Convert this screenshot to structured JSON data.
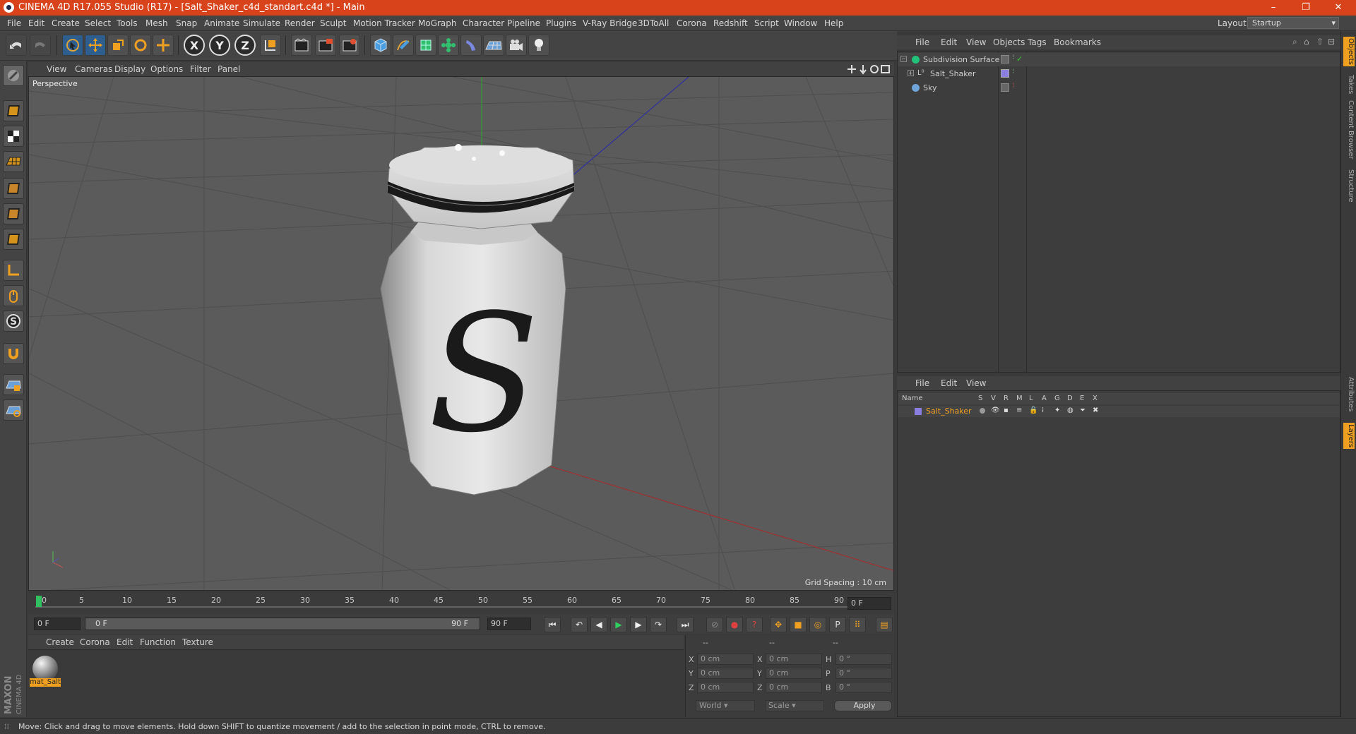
{
  "window": {
    "title": "CINEMA 4D R17.055 Studio (R17) - [Salt_Shaker_c4d_standart.c4d *] - Main",
    "controls": [
      "–",
      "❐",
      "✕"
    ],
    "accent_color": "#d8431b"
  },
  "menubar": {
    "items": [
      "File",
      "Edit",
      "Create",
      "Select",
      "Tools",
      "Mesh",
      "Snap",
      "Animate",
      "Simulate",
      "Render",
      "Sculpt",
      "Motion Tracker",
      "MoGraph",
      "Character",
      "Pipeline",
      "Plugins",
      "V-Ray Bridge",
      "3DToAll",
      "Corona",
      "Redshift",
      "Script",
      "Window",
      "Help"
    ],
    "layout_label": "Layout:",
    "layout_value": "Startup"
  },
  "toolbar": {
    "axis_x": "X",
    "axis_y": "Y",
    "axis_z": "Z",
    "icons": [
      "undo-icon",
      "redo-icon",
      "select-icon",
      "move-icon",
      "scale-icon",
      "rotate-icon",
      "transform-icon",
      "axis-x-icon",
      "axis-y-icon",
      "axis-z-icon",
      "coordinate-system-icon",
      "render-view-icon",
      "render-picture-viewer-icon",
      "render-settings-icon",
      "cube-icon",
      "spline-pen-icon",
      "subdivision-icon",
      "array-icon",
      "deformer-icon",
      "floor-icon",
      "camera-icon",
      "light-icon"
    ]
  },
  "viewport": {
    "menu": [
      "View",
      "Cameras",
      "Display",
      "Options",
      "Filter",
      "Panel"
    ],
    "label": "Perspective",
    "grid_spacing": "Grid Spacing : 10 cm",
    "object_letter": "S"
  },
  "timeline": {
    "ticks": [
      "0",
      "5",
      "10",
      "15",
      "20",
      "25",
      "30",
      "35",
      "40",
      "45",
      "50",
      "55",
      "60",
      "65",
      "70",
      "75",
      "80",
      "85",
      "90"
    ],
    "current_frame": "0 F",
    "start_frame": "0 F",
    "range_start": "0 F",
    "range_end": "90 F",
    "end_frame": "90 F"
  },
  "material_manager": {
    "menu": [
      "Create",
      "Corona",
      "Edit",
      "Function",
      "Texture"
    ],
    "material_name": "mat_Salt"
  },
  "coordinates": {
    "header": [
      "--",
      "--",
      "--"
    ],
    "rows": [
      {
        "axis": "X",
        "pos": "0 cm",
        "axis2": "X",
        "size": "0 cm",
        "axis3": "H",
        "rot": "0 °"
      },
      {
        "axis": "Y",
        "pos": "0 cm",
        "axis2": "Y",
        "size": "0 cm",
        "axis3": "P",
        "rot": "0 °"
      },
      {
        "axis": "Z",
        "pos": "0 cm",
        "axis2": "Z",
        "size": "0 cm",
        "axis3": "B",
        "rot": "0 °"
      }
    ],
    "mode_world": "World",
    "mode_scale": "Scale",
    "apply_label": "Apply"
  },
  "object_manager": {
    "menu": [
      "File",
      "Edit",
      "View",
      "Objects",
      "Tags",
      "Bookmarks"
    ],
    "objects": [
      {
        "name": "Subdivision Surface",
        "color": "#22c27a"
      },
      {
        "name": "Salt_Shaker",
        "color": "#d0d0d0"
      },
      {
        "name": "Sky",
        "color": "#6fa4d8"
      }
    ]
  },
  "layer_manager": {
    "menu": [
      "File",
      "Edit",
      "View"
    ],
    "columns": [
      "Name",
      "S",
      "V",
      "R",
      "M",
      "L",
      "A",
      "G",
      "D",
      "E",
      "X"
    ],
    "layers": [
      {
        "name": "Salt_Shaker",
        "color": "#8a7ee0"
      }
    ]
  },
  "right_tabs": [
    "Objects",
    "Takes",
    "Content Browser",
    "Structure",
    "Attributes",
    "Layers"
  ],
  "status": "Move: Click and drag to move elements. Hold down SHIFT to quantize movement / add to the selection in point mode, CTRL to remove.",
  "branding": {
    "maxon": "MAXON",
    "cinema": "CINEMA 4D"
  }
}
